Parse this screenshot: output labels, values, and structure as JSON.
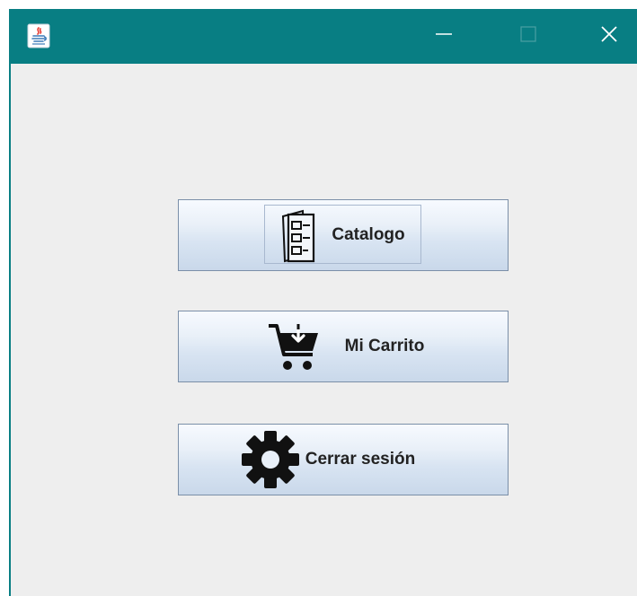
{
  "window": {
    "title": "",
    "controls": {
      "minimize": "minimize-icon",
      "maximize": "maximize-icon",
      "close": "close-icon"
    }
  },
  "menu": {
    "buttons": [
      {
        "label": "Catalogo",
        "icon": "catalog-list-icon"
      },
      {
        "label": "Mi Carrito",
        "icon": "shopping-cart-download-icon"
      },
      {
        "label": "Cerrar sesión",
        "icon": "gear-icon"
      }
    ]
  },
  "colors": {
    "titlebar": "#087e83",
    "window_bg": "#eeeeee",
    "button_border": "#7b8fa8"
  }
}
